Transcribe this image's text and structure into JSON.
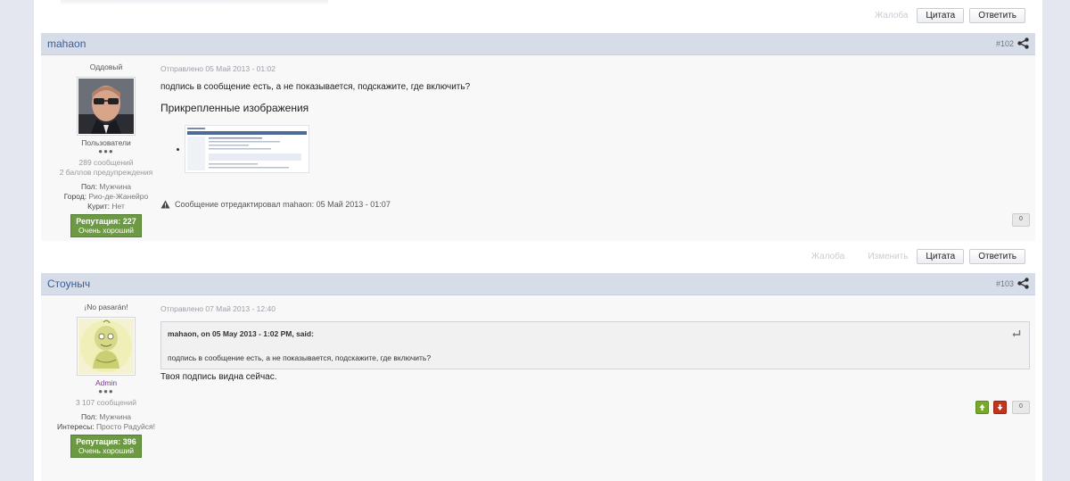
{
  "post_top": {
    "actions": {
      "report": "Жалоба",
      "quote": "Цитата",
      "reply": "Ответить"
    }
  },
  "post_102": {
    "author": "mahaon",
    "number": "#102",
    "author_title": "Оддовый",
    "group": "Пользователи",
    "group_dots": "●●●",
    "posts": "289 сообщений",
    "warnings": "2 баллов предупреждения",
    "gender_label": "Пол:",
    "gender_value": "Мужчина",
    "city_label": "Город:",
    "city_value": "Рио-де-Жанейро",
    "smoke_label": "Курит:",
    "smoke_value": "Нет",
    "reputation": "Репутация: 227",
    "reputation_desc": "Очень хороший",
    "posted": "Отправлено 05 Май 2013 - 01:02",
    "message": "подпись в сообщение есть, а не показывается, подскажите, где включить?",
    "attachments_title": "Прикрепленные изображения",
    "edit_note": "Сообщение отредактировал mahaon: 05 Май 2013 - 01:07",
    "rating": "0",
    "actions": {
      "report": "Жалоба",
      "edit": "Изменить",
      "quote": "Цитата",
      "reply": "Ответить"
    }
  },
  "post_103": {
    "author": "Стоуныч",
    "number": "#103",
    "author_title": "¡No pasarán!",
    "group": "Admin",
    "group_dots": "●●●",
    "posts": "3 107 сообщений",
    "gender_label": "Пол:",
    "gender_value": "Мужчина",
    "interests_label": "Интересы:",
    "interests_value": "Просто Радуйся!",
    "reputation": "Репутация: 396",
    "reputation_desc": "Очень хороший",
    "posted": "Отправлено 07 Май 2013 - 12:40",
    "quote_cite": "mahaon, on 05 May 2013 - 1:02 PM, said:",
    "quote_text": "подпись в сообщение есть, а не показывается, подскажите, где включить?",
    "message": "Твоя подпись видна сейчас.",
    "rating": "0"
  },
  "colors": {
    "page_bg": "#e4e7ef",
    "post_header_bg": "#d7dde8",
    "author_link": "#3a5e96",
    "reputation_bg": "#6b9a42",
    "admin_group": "#7a3a9a",
    "vote_up": "#7aa82a",
    "vote_down": "#c2341d"
  },
  "icons": {
    "share": "share-icon",
    "warning": "warning-icon",
    "quote_back": "quote-back-arrow-icon",
    "vote_up": "arrow-up-icon",
    "vote_down": "arrow-down-icon"
  }
}
